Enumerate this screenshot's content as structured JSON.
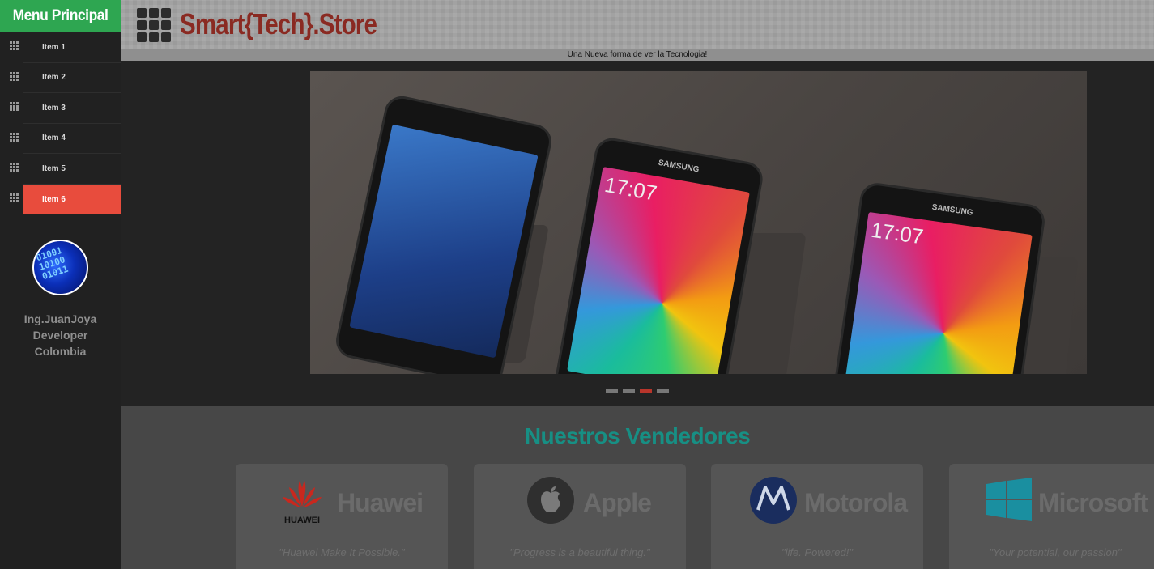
{
  "sidebar": {
    "title": "Menu Principal",
    "items": [
      {
        "label": "Item 1"
      },
      {
        "label": "Item 2"
      },
      {
        "label": "Item 3"
      },
      {
        "label": "Item 4"
      },
      {
        "label": "Item 5"
      },
      {
        "label": "Item 6",
        "active": true
      }
    ],
    "profile": {
      "avatar_text": "01001\n10100\n01011",
      "name": "Ing.JuanJoya",
      "role": "Developer",
      "country": "Colombia"
    }
  },
  "header": {
    "brand": "Smart{Tech}.Store",
    "tagline": "Una Nueva forma de ver la Tecnologia!"
  },
  "slider": {
    "phones": [
      {
        "brand": "",
        "time": ""
      },
      {
        "brand": "SAMSUNG",
        "time": "17:07"
      },
      {
        "brand": "SAMSUNG",
        "time": "17:07"
      }
    ],
    "dots_count": 4,
    "active_dot": 2
  },
  "vendors": {
    "title": "Nuestros Vendedores",
    "items": [
      {
        "name": "Huawei",
        "slogan": "\"Huawei Make It Possible.\"",
        "logo_text": "HUAWEI"
      },
      {
        "name": "Apple",
        "slogan": "\"Progress is a beautiful thing.\""
      },
      {
        "name": "Motorola",
        "slogan": "\"life. Powered!\""
      },
      {
        "name": "Microsoft",
        "slogan": "\"Your potential, our passion\""
      }
    ]
  },
  "colors": {
    "accent_green": "#2ea651",
    "active_red": "#e84c3d",
    "brand_red": "#8a2a22",
    "teal": "#178f84"
  }
}
